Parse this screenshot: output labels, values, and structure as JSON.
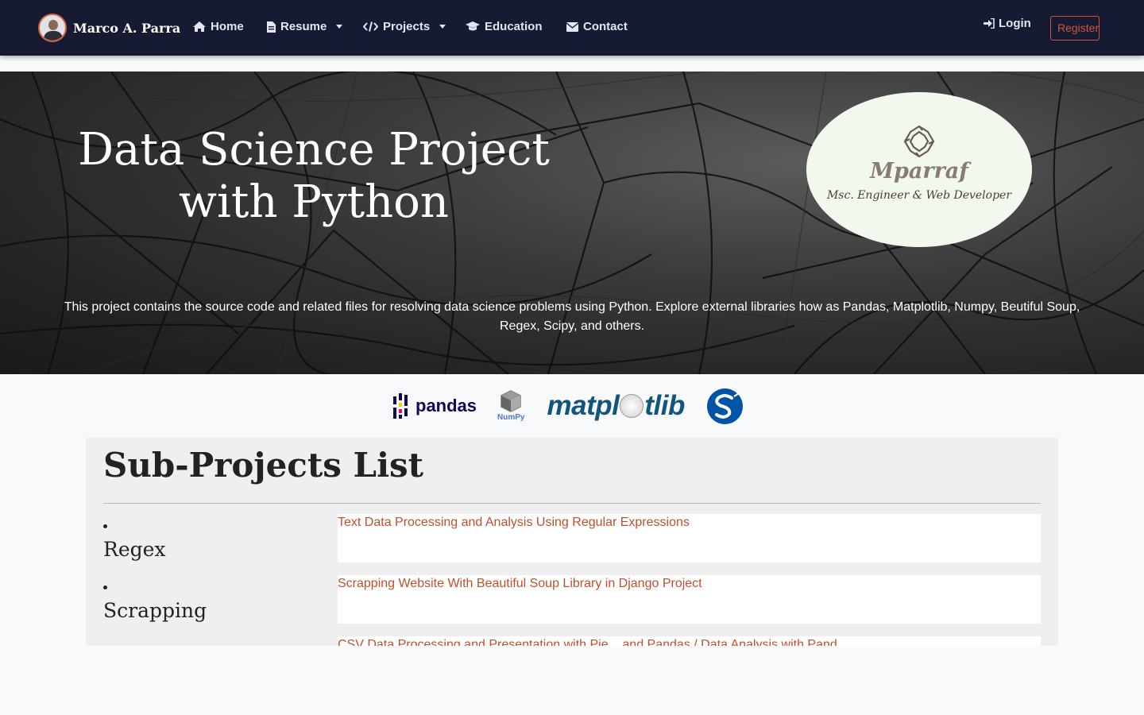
{
  "navbar": {
    "brand": "Marco A. Parra",
    "items": [
      {
        "label": "Home",
        "icon": "home-icon"
      },
      {
        "label": "Resume",
        "icon": "file-icon",
        "dropdown": true
      },
      {
        "label": "Projects",
        "icon": "code-icon",
        "dropdown": true
      },
      {
        "label": "Education",
        "icon": "graduation-cap-icon"
      },
      {
        "label": "Contact",
        "icon": "envelope-icon"
      }
    ],
    "login": "Login",
    "register": "Register"
  },
  "hero": {
    "title_line1": "Data Science Project",
    "title_line2": "with Python",
    "logo_name": "Mparraf",
    "logo_tagline": "Msc. Engineer & Web Developer",
    "description": "This project contains the source code and related files for resolving data science problems using Python. Explore external libraries how as Pandas, Matplotlib, Numpy, Beutiful Soup, Regex, Scipy, and others."
  },
  "libraries": {
    "pandas": "pandas",
    "numpy": "NumPy",
    "matplotlib_left": "matpl",
    "matplotlib_right": "tlib"
  },
  "subprojects": {
    "title": "Sub-Projects List",
    "items": [
      {
        "category": "Regex",
        "link": "Text Data Processing and Analysis Using Regular Expressions"
      },
      {
        "category": "Scrapping",
        "link": "Scrapping Website With Beautiful Soup Library in Django Project"
      },
      {
        "category": "",
        "link": "CSV Data Processing and Presentation with Pie...  and Pandas / Data Analysis with Pand..."
      }
    ]
  },
  "colors": {
    "navbar_bg": "#161b33",
    "accent": "#d0553a",
    "link": "#c14f2d",
    "card_bg": "#efefef"
  }
}
